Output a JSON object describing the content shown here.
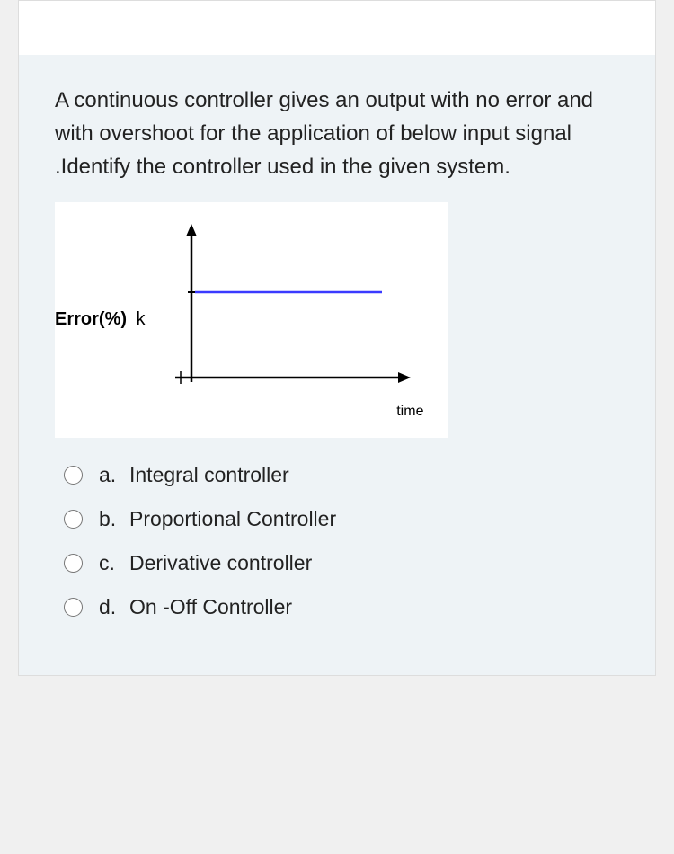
{
  "question": {
    "text": "A continuous controller gives an output with no error and with overshoot  for  the application of below input signal .Identify the controller used in the given system."
  },
  "chart_data": {
    "type": "line",
    "title": "",
    "ylabel": "Error(%)",
    "ytick_label": "k",
    "xlabel": "time",
    "description": "Step input: error jumps from 0 to constant value k at t=0 and stays at k.",
    "series": [
      {
        "name": "error",
        "x": [
          0,
          1
        ],
        "y": [
          "k",
          "k"
        ]
      }
    ],
    "x_origin": 0,
    "xlim": [
      -0.1,
      1
    ],
    "ylim": [
      0,
      "k"
    ]
  },
  "options": [
    {
      "letter": "a.",
      "label": "Integral controller"
    },
    {
      "letter": "b.",
      "label": "Proportional Controller"
    },
    {
      "letter": "c.",
      "label": "Derivative controller"
    },
    {
      "letter": "d.",
      "label": "On -Off Controller"
    }
  ]
}
